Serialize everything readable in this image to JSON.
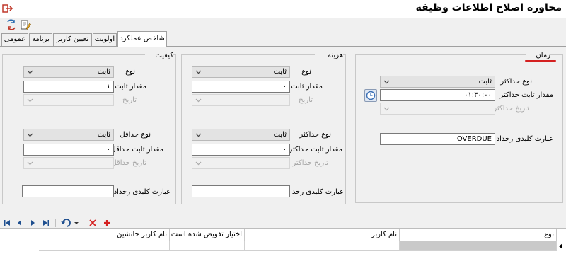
{
  "window": {
    "title": "محاوره اصلاح اطلاعات وظیفه"
  },
  "tabs": [
    {
      "label": "عمومی",
      "active": false
    },
    {
      "label": "برنامه",
      "active": false
    },
    {
      "label": "تعیین کاربر",
      "active": false
    },
    {
      "label": "اولویت",
      "active": false
    },
    {
      "label": "شاخص عملکرد",
      "active": true
    }
  ],
  "time_group": {
    "title": "زمان",
    "type_label": "نوع حداکثر",
    "type_value": "ثابت",
    "const_label": "مقدار ثابت حداکثر",
    "const_value": "۰۱:۳۰:۰۰",
    "date_label": "تاریخ حداکثر",
    "event_label": "عبارت کلیدی رخداد",
    "event_value": "OVERDUE"
  },
  "cost_group": {
    "title": "هزینه",
    "max_type_label": "نوع",
    "max_type_value": "ثابت",
    "max_const_label": "مقدار ثابت",
    "max_const_value": "۰",
    "max_date_label": "تاریخ",
    "min_type_label": "نوع حداکثر",
    "min_type_value": "ثابت",
    "min_const_label": "مقدار ثابت حداکثر",
    "min_const_value": "۰",
    "min_date_label": "تاریخ حداکثر",
    "event_label": "عبارت کلیدی رخداد",
    "event_value": ""
  },
  "quality_group": {
    "title": "کیفیت",
    "max_type_label": "نوع",
    "max_type_value": "ثابت",
    "max_const_label": "مقدار ثابت",
    "max_const_value": "۱",
    "max_date_label": "تاریخ",
    "min_type_label": "نوع حداقل",
    "min_type_value": "ثابت",
    "min_const_label": "مقدار ثابت حداقل",
    "min_const_value": "۰",
    "min_date_label": "تاریخ حداقل",
    "event_label": "عبارت کلیدی رخداد",
    "event_value": ""
  },
  "grid": {
    "columns": [
      "نوع",
      "نام کاربر",
      "اختیار تفویض شده است",
      "نام کاربر جانشین"
    ]
  },
  "colors": {
    "accent_underline": "#d42020",
    "clock_button": "#3a6fb5",
    "delete_icon": "#d42020",
    "add_icon": "#d42020"
  }
}
